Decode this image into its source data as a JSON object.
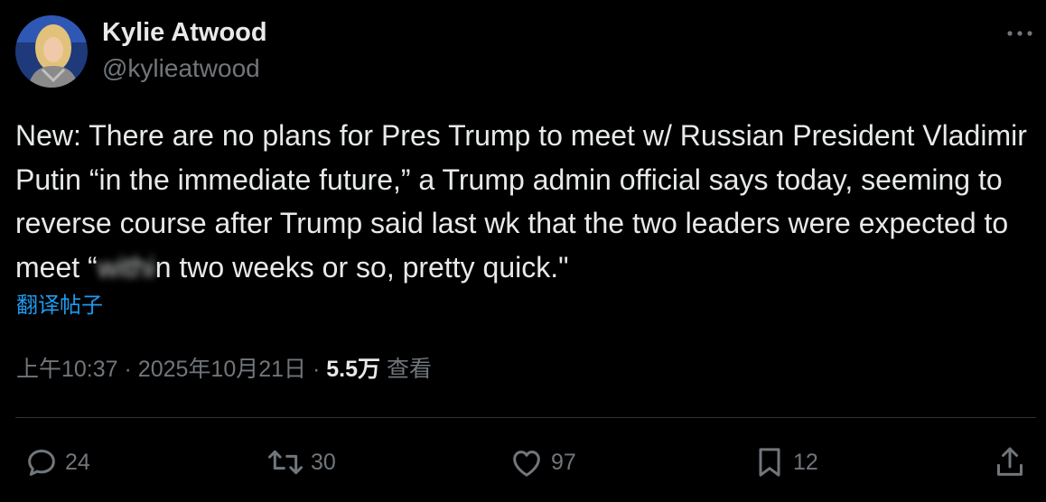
{
  "author": {
    "name": "Kylie Atwood",
    "handle": "@kylieatwood"
  },
  "tweet": {
    "text_before_blur": "New: There are no plans for Pres Trump to meet w/ Russian President Vladimir Putin “in the immediate future,” a Trump admin official says today, seeming to reverse course after Trump said last wk that the two leaders were expected to meet “",
    "text_blurred": "withi",
    "text_after_blur": "n two weeks or so, pretty quick.\""
  },
  "translate_label": "翻译帖子",
  "meta": {
    "time": "上午10:37",
    "separator": "·",
    "date": "2025年10月21日",
    "views_count": "5.5万",
    "views_label": "查看"
  },
  "actions": {
    "replies": "24",
    "reposts": "30",
    "likes": "97",
    "bookmarks": "12"
  },
  "icons": [
    "avatar",
    "more-icon",
    "reply-icon",
    "repost-icon",
    "like-icon",
    "bookmark-icon",
    "share-icon"
  ],
  "colors": {
    "background": "#000000",
    "text": "#e7e9ea",
    "secondary": "#71767b",
    "link": "#1d9bf0",
    "divider": "#2f3336"
  }
}
